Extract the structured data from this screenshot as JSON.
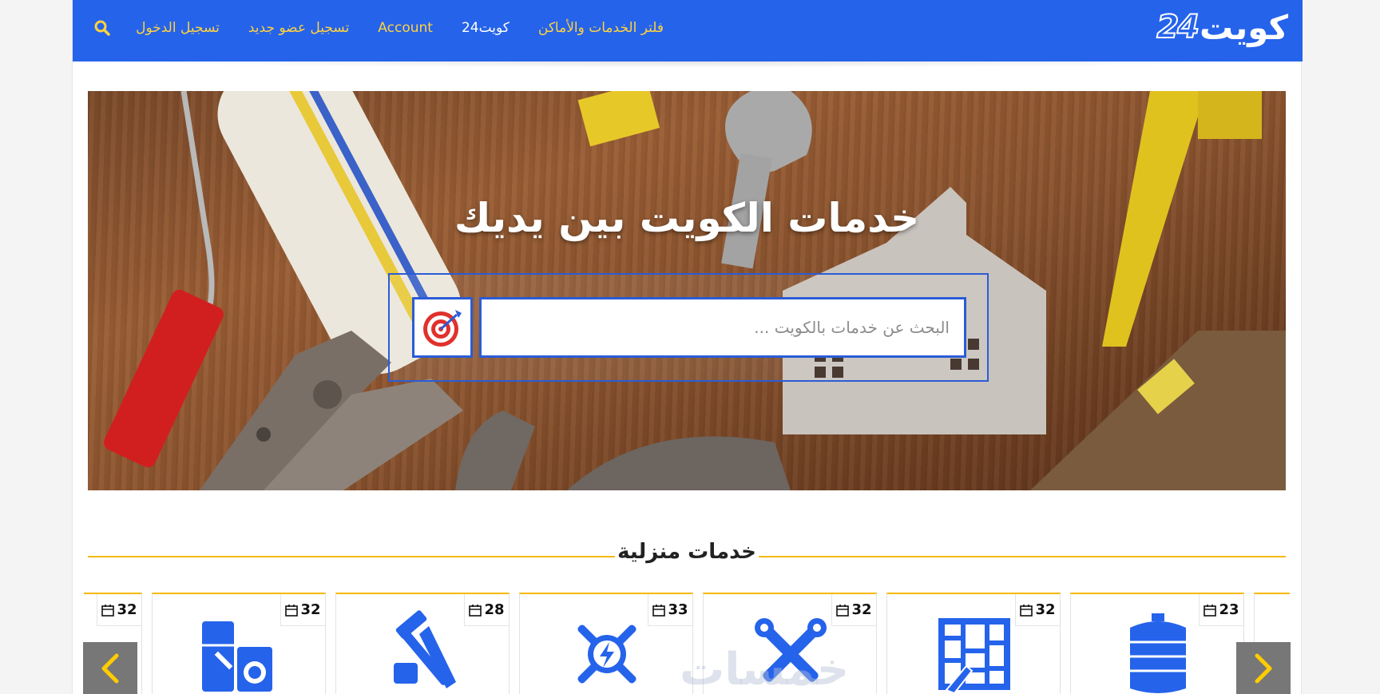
{
  "header": {
    "logo_text": "كويت",
    "logo_digits": "24",
    "nav": [
      {
        "label": "فلتر الخدمات والأماكن"
      },
      {
        "label": "كويت24"
      },
      {
        "label": "Account"
      },
      {
        "label": "تسجيل عضو جديد"
      },
      {
        "label": "تسجيل الدخول"
      }
    ],
    "search_icon": "search-icon"
  },
  "hero": {
    "title": "خدمات الكويت بين يديك",
    "search_placeholder": "البحث عن خدمات بالكويت ...",
    "search_button_icon": "target-icon"
  },
  "section": {
    "title": "خدمات منزلية"
  },
  "cards": [
    {
      "count": "23",
      "icon": "water-tank-icon"
    },
    {
      "count": "32",
      "icon": "floor-tiles-icon"
    },
    {
      "count": "32",
      "icon": "plumbing-tools-icon"
    },
    {
      "count": "33",
      "icon": "electric-tools-icon"
    },
    {
      "count": "28",
      "icon": "carpentry-tools-icon"
    },
    {
      "count": "32",
      "icon": "appliance-repair-icon"
    },
    {
      "count": "32",
      "icon": "service-icon"
    }
  ],
  "watermark": "خمسات",
  "colors": {
    "primary": "#2563eb",
    "accent": "#f5b800",
    "nav_text": "#ffd23f"
  }
}
